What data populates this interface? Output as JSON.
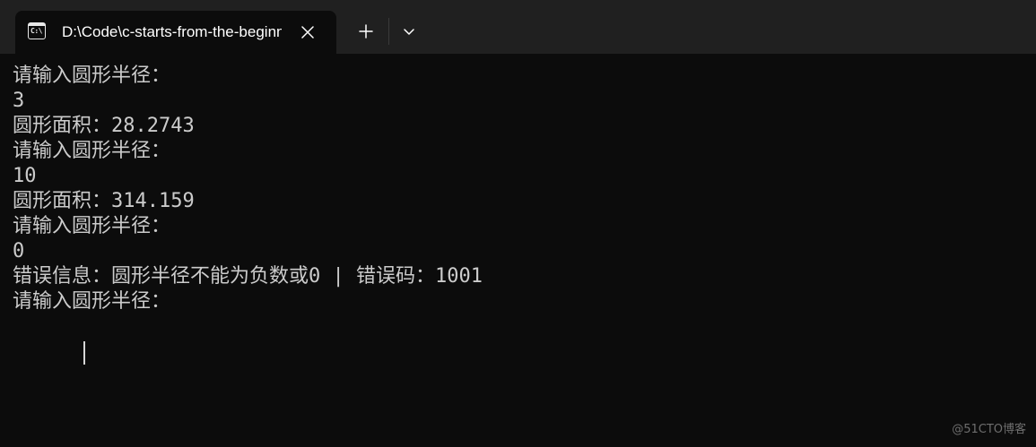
{
  "tab": {
    "title": "D:\\Code\\c-starts-from-the-beginning",
    "icon_text": "C:\\"
  },
  "terminal": {
    "lines": [
      "请输入圆形半径：",
      "3",
      "圆形面积：28.2743",
      "请输入圆形半径：",
      "10",
      "圆形面积：314.159",
      "请输入圆形半径：",
      "0",
      "错误信息：圆形半径不能为负数或0 | 错误码：1001",
      "请输入圆形半径："
    ]
  },
  "watermark": "@51CTO博客",
  "icons": {
    "tab": "terminal-icon",
    "close": "close-icon",
    "new_tab": "plus-icon",
    "dropdown": "chevron-down-icon"
  },
  "colors": {
    "background": "#0c0c0c",
    "tabbar": "#202020",
    "text": "#cccccc"
  }
}
